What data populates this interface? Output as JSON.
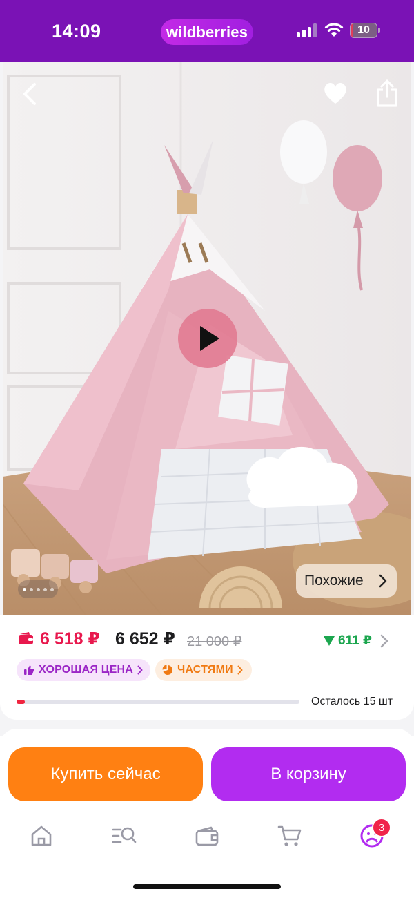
{
  "status_bar": {
    "time": "14:09",
    "app_badge": "wildberries",
    "battery_level": "10",
    "battery_fraction": 0.1,
    "icons": [
      "cellular-signal-icon",
      "wifi-icon",
      "battery-icon"
    ]
  },
  "gallery": {
    "icons": [
      "back-arrow-icon",
      "heart-icon",
      "share-icon",
      "play-icon"
    ],
    "image_count": 5,
    "current_image": 1,
    "similar_label": "Похожие"
  },
  "price": {
    "wallet_price": "6 518 ₽",
    "regular_price": "6 652 ₽",
    "old_price": "21 000 ₽",
    "price_drop": "611 ₽",
    "colors": {
      "wallet": "#e8184d",
      "drop": "#1ca64f"
    }
  },
  "badges": {
    "good_price": "ХОРОШАЯ ЦЕНА",
    "installments": "ЧАСТЯМИ"
  },
  "stock": {
    "label": "Осталось 15 шт",
    "fill_fraction": 0.03
  },
  "actions": {
    "buy_now": "Купить сейчас",
    "add_to_cart": "В корзину",
    "colors": {
      "buy_now": "#ff8012",
      "add_to_cart": "#b22cf0"
    }
  },
  "tabbar": {
    "items": [
      {
        "icon": "home-icon"
      },
      {
        "icon": "catalog-search-icon"
      },
      {
        "icon": "wallet-icon"
      },
      {
        "icon": "cart-icon"
      },
      {
        "icon": "profile-icon"
      }
    ],
    "profile_badge": "3"
  },
  "accent": "#7a12b5"
}
